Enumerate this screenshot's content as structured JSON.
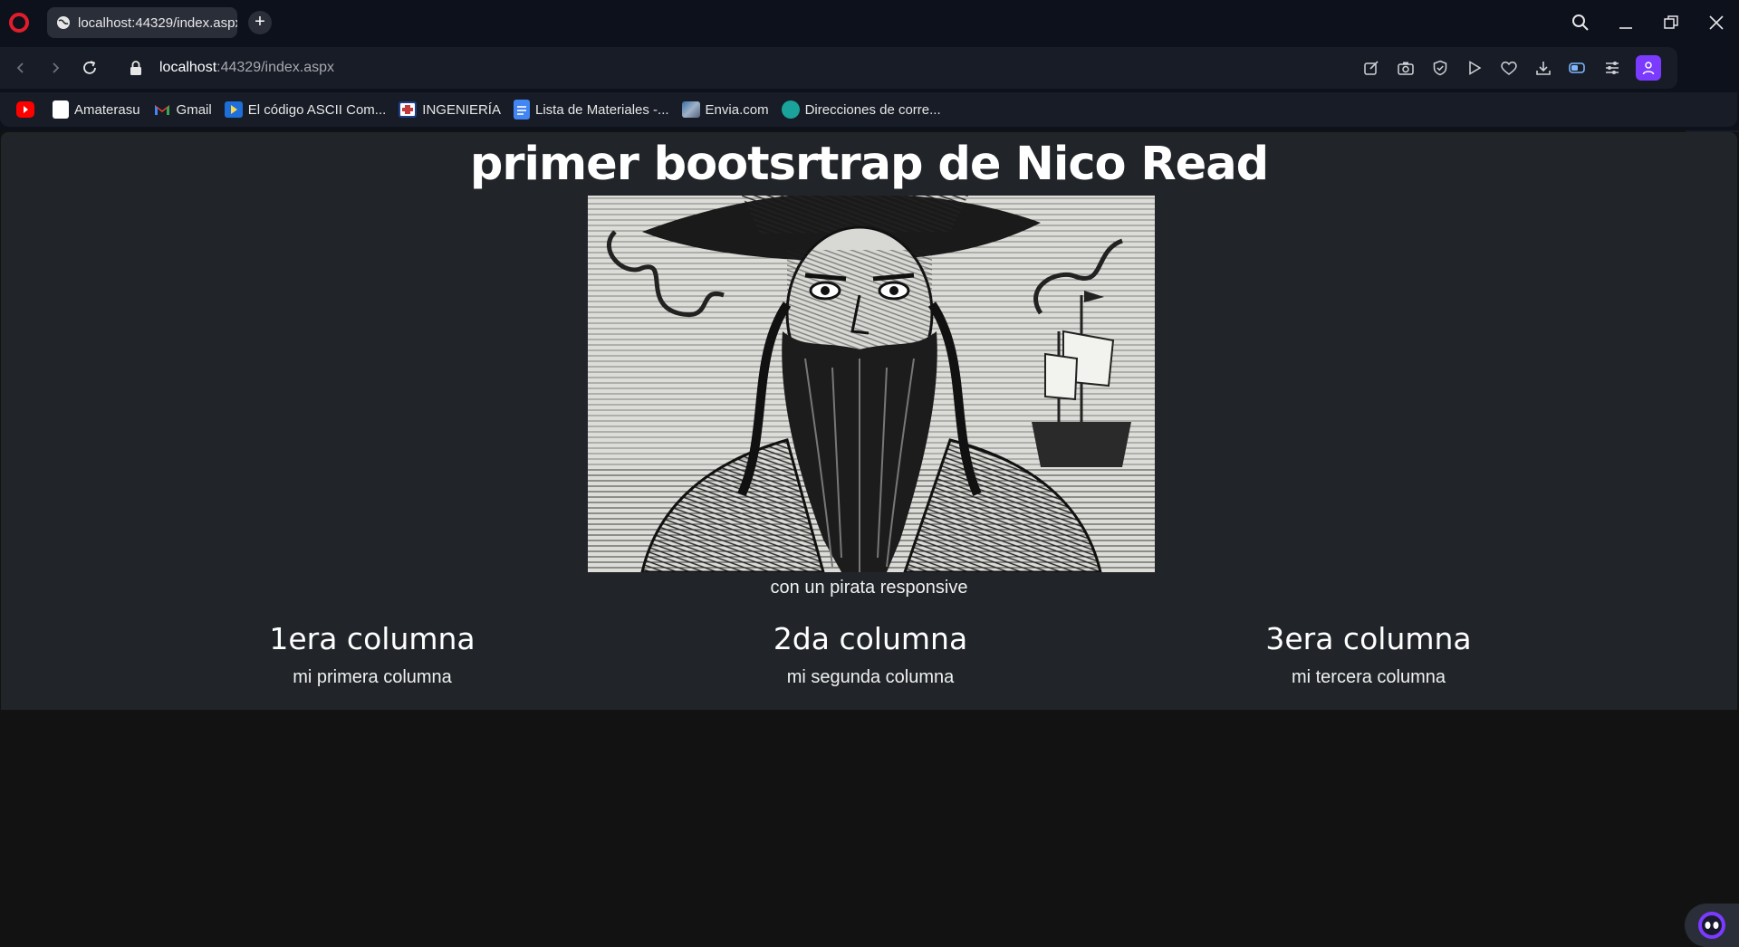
{
  "browser": {
    "tab_title": "localhost:44329/index.aspx",
    "new_tab_label": "+",
    "url_host": "localhost",
    "url_rest": ":44329/index.aspx"
  },
  "bookmarks": [
    {
      "label": "",
      "icon": "youtube-icon",
      "color": "#ff0000"
    },
    {
      "label": "Amaterasu",
      "icon": "bookmark-page-icon",
      "color": "#ffffff"
    },
    {
      "label": "Gmail",
      "icon": "gmail-icon",
      "color": "#ea4335"
    },
    {
      "label": "El código ASCII Com...",
      "icon": "ascii-site-icon",
      "color": "#1e6fd9"
    },
    {
      "label": "INGENIERÍA",
      "icon": "ingenieria-icon",
      "color": "#c23b3b"
    },
    {
      "label": "Lista de Materiales -...",
      "icon": "docs-icon",
      "color": "#4285f4"
    },
    {
      "label": "Envia.com",
      "icon": "envia-icon",
      "color": "#3a6ea5"
    },
    {
      "label": "Direcciones de corre...",
      "icon": "mail-directions-icon",
      "color": "#1aa39a"
    }
  ],
  "page": {
    "title": "primer bootsrtrap de Nico Read",
    "caption": "con un pirata responsive",
    "columns": [
      {
        "heading": "1era columna",
        "text": "mi primera columna"
      },
      {
        "heading": "2da columna",
        "text": "mi segunda columna"
      },
      {
        "heading": "3era columna",
        "text": "mi tercera columna"
      }
    ]
  },
  "colors": {
    "chrome_bg": "#0d111c",
    "container_bg": "#212529",
    "accent": "#7b3bff"
  }
}
